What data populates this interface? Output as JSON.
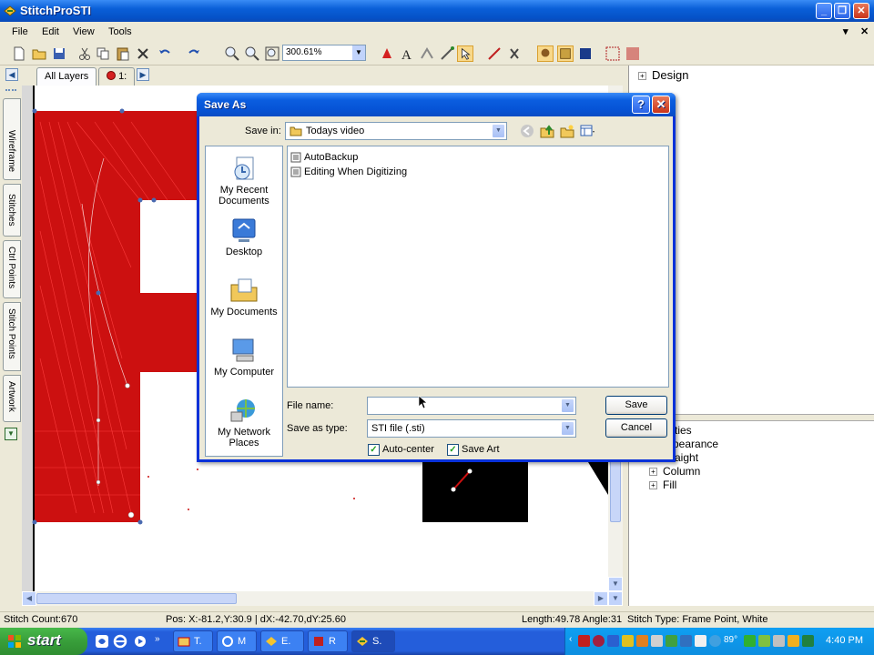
{
  "app": {
    "title": "StitchProSTI"
  },
  "menu": {
    "items": [
      "File",
      "Edit",
      "View",
      "Tools"
    ]
  },
  "toolbar": {
    "zoom": "300.61%"
  },
  "layers": {
    "all_layers_tab": "All Layers",
    "layer1_tab": "1:"
  },
  "side_tabs": [
    "Wireframe",
    "Stitches",
    "Ctrl Points",
    "Stitch Points",
    "Artwork"
  ],
  "right_panel": {
    "top_root": "Design",
    "bottom_items": [
      "rties",
      "pearance",
      "aight",
      "Column",
      "Fill"
    ]
  },
  "status": {
    "stitch_count": "Stitch Count:670",
    "pos": "Pos:  X:-81.2,Y:30.9 | dX:-42.70,dY:25.60",
    "length": "Length:49.78 Angle:31",
    "stitch_type": "Stitch Type: Frame Point, White"
  },
  "dialog": {
    "title": "Save As",
    "save_in_label": "Save in:",
    "save_in_value": "Todays video",
    "places": [
      "My Recent Documents",
      "Desktop",
      "My Documents",
      "My Computer",
      "My Network Places"
    ],
    "files": [
      "AutoBackup",
      "Editing When Digitizing"
    ],
    "file_name_label": "File name:",
    "file_name_value": "",
    "save_as_type_label": "Save as type:",
    "save_as_type_value": "STI file (.sti)",
    "auto_center": "Auto-center",
    "save_art": "Save Art",
    "save_button": "Save",
    "cancel_button": "Cancel"
  },
  "taskbar": {
    "start": "start",
    "tasks": [
      "T.",
      "M",
      "E.",
      "R",
      "S."
    ],
    "temperature": "89°",
    "clock": "4:40 PM"
  }
}
